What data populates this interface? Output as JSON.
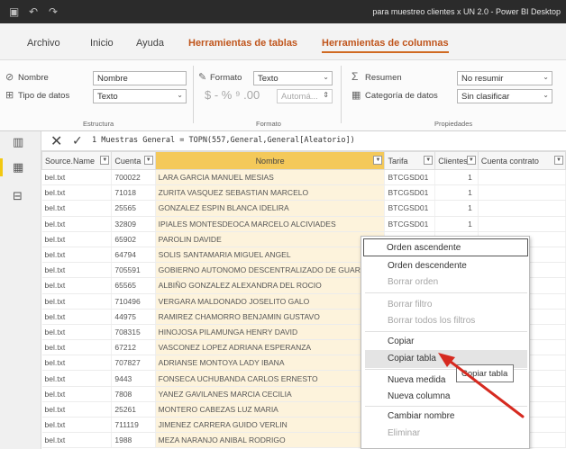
{
  "window": {
    "title": "para muestreo clientes x UN 2.0 - Power BI Desktop"
  },
  "ribbon_tabs": [
    {
      "label": "Archivo"
    },
    {
      "label": "Inicio"
    },
    {
      "label": "Ayuda"
    },
    {
      "label": "Herramientas de tablas"
    },
    {
      "label": "Herramientas de columnas"
    }
  ],
  "ribbon": {
    "estructura": {
      "name_label": "Nombre",
      "name_value": "Nombre",
      "type_label": "Tipo de datos",
      "type_value": "Texto",
      "group_name": "Estructura"
    },
    "formato": {
      "format_label": "Formato",
      "format_value": "Texto",
      "symbols": "$ - % ⁹ .00",
      "auto_value": "Automá...",
      "group_name": "Formato"
    },
    "propiedades": {
      "summary_label": "Resumen",
      "summary_value": "No resumir",
      "category_label": "Categoría de datos",
      "category_value": "Sin clasificar",
      "group_name": "Propiedades"
    }
  },
  "formula_bar": {
    "formula": "1  Muestras General = TOPN(557,General,General[Aleatorio])"
  },
  "table": {
    "columns": [
      "Source.Name",
      "Cuenta",
      "Nombre",
      "Tarifa",
      "Clientes",
      "Cuenta contrato"
    ],
    "rows": [
      [
        "bel.txt",
        "700022",
        "LARA GARCIA MANUEL MESIAS",
        "BTCGSD01",
        "1",
        ""
      ],
      [
        "bel.txt",
        "71018",
        "ZURITA VASQUEZ SEBASTIAN MARCELO",
        "BTCGSD01",
        "1",
        ""
      ],
      [
        "bel.txt",
        "25565",
        "GONZALEZ ESPIN BLANCA IDELIRA",
        "BTCGSD01",
        "1",
        ""
      ],
      [
        "bel.txt",
        "32809",
        "IPIALES MONTESDEOCA MARCELO ALCIVIADES",
        "BTCGSD01",
        "1",
        ""
      ],
      [
        "bel.txt",
        "65902",
        "PAROLIN DAVIDE",
        "BTCGSD01",
        "",
        ""
      ],
      [
        "bel.txt",
        "64794",
        "SOLIS SANTAMARIA MIGUEL ANGEL",
        "",
        "",
        ""
      ],
      [
        "bel.txt",
        "705591",
        "GOBIERNO AUTONOMO DESCENTRALIZADO DE GUARANDA",
        "",
        "",
        ""
      ],
      [
        "bel.txt",
        "65565",
        "ALBIÑO GONZALEZ ALEXANDRA DEL ROCIO",
        "",
        "",
        ""
      ],
      [
        "bel.txt",
        "710496",
        "VERGARA MALDONADO JOSELITO GALO",
        "",
        "",
        ""
      ],
      [
        "bel.txt",
        "44975",
        "RAMIREZ CHAMORRO BENJAMIN GUSTAVO",
        "",
        "",
        ""
      ],
      [
        "bel.txt",
        "708315",
        "HINOJOSA PILAMUNGA HENRY DAVID",
        "",
        "",
        ""
      ],
      [
        "bel.txt",
        "67212",
        "VASCONEZ LOPEZ ADRIANA ESPERANZA",
        "",
        "",
        ""
      ],
      [
        "bel.txt",
        "707827",
        "ADRIANSE MONTOYA LADY IBANA",
        "",
        "",
        ""
      ],
      [
        "bel.txt",
        "9443",
        "FONSECA UCHUBANDA CARLOS ERNESTO",
        "",
        "",
        ""
      ],
      [
        "bel.txt",
        "7808",
        "YANEZ GAVILANES MARCIA CECILIA",
        "",
        "",
        ""
      ],
      [
        "bel.txt",
        "25261",
        "MONTERO CABEZAS LUZ MARIA",
        "",
        "",
        ""
      ],
      [
        "bel.txt",
        "711119",
        "JIMENEZ CARRERA GUIDO VERLIN",
        "",
        "",
        ""
      ],
      [
        "bel.txt",
        "1988",
        "MEZA NARANJO ANIBAL RODRIGO",
        "",
        "",
        ""
      ]
    ]
  },
  "context_menu": {
    "items": [
      {
        "label": "Orden ascendente",
        "enabled": true
      },
      {
        "label": "Orden descendente",
        "enabled": true
      },
      {
        "label": "Borrar orden",
        "enabled": false
      },
      {
        "label": "Borrar filtro",
        "enabled": false
      },
      {
        "label": "Borrar todos los filtros",
        "enabled": false
      },
      {
        "label": "Copiar",
        "enabled": true
      },
      {
        "label": "Copiar tabla",
        "enabled": true
      },
      {
        "label": "Nueva medida",
        "enabled": true
      },
      {
        "label": "Nueva columna",
        "enabled": true
      },
      {
        "label": "Cambiar nombre",
        "enabled": true
      },
      {
        "label": "Eliminar",
        "enabled": false
      }
    ],
    "tooltip": "Copiar tabla"
  },
  "colors": {
    "accent_orange": "#c0551c",
    "selected_header": "#f4c95a",
    "annotation_arrow": "#d62a20"
  }
}
